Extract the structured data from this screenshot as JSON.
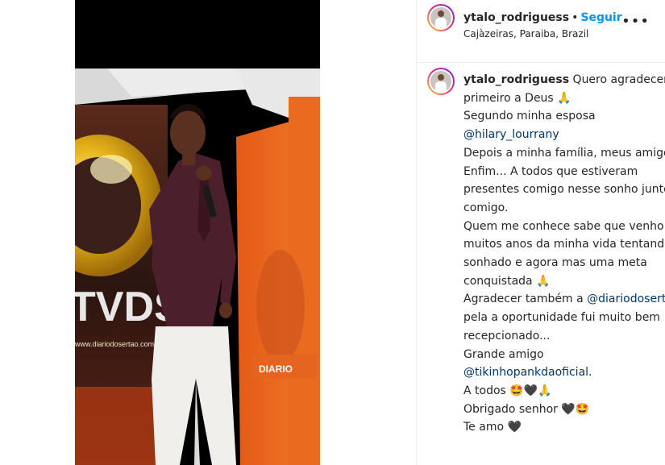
{
  "post": {
    "username": "ytalo_rodriguess",
    "dot": "•",
    "follow_label": "Seguir",
    "location": "Cajàzeiras, Paraiba, Brazil",
    "more_icon": "•••"
  },
  "photo": {
    "banner_text": "TVDS",
    "site_text": "www.diariodosertao.com.br",
    "brand_text": "DIARIO"
  },
  "caption": {
    "username": "ytalo_rodriguess",
    "lines": [
      " Quero agradecer",
      "primeiro a Deus 🙏",
      "Segundo minha esposa",
      "@hilary_lourrany",
      "Depois a minha família, meus amigos",
      "Enfim... A todos que estiveram",
      "presentes comigo nesse sonho junto",
      "comigo.",
      "Quem me conhece sabe que venho a",
      "muitos anos da minha vida tentando e",
      "sonhado e agora mas uma meta",
      "conquistada 🙏",
      "Agradecer também a ",
      "@diariodosertao",
      "pela a oportunidade fui muito bem",
      "recepcionado...",
      "Grande amigo",
      "@tikinhopankdaoficial.",
      "A todos 🤩🖤🙏",
      "Obrigado senhor 🖤🤩",
      "Te amo 🖤"
    ]
  }
}
